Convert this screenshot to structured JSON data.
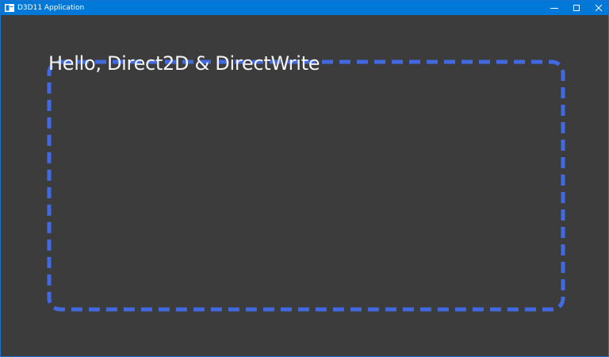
{
  "window": {
    "title": "D3D11 Application",
    "icons": {
      "app": "window-app-icon",
      "minimize": "minimize-icon",
      "maximize": "maximize-icon",
      "close": "close-icon"
    },
    "colors": {
      "titlebar": "#0078d7",
      "client_background": "#3c3c3c"
    }
  },
  "canvas": {
    "text": "Hello, Direct2D & DirectWrite",
    "text_color": "#f4f4f4",
    "rect_stroke_color": "#4169e1",
    "rect_style": "dashed-rounded"
  }
}
